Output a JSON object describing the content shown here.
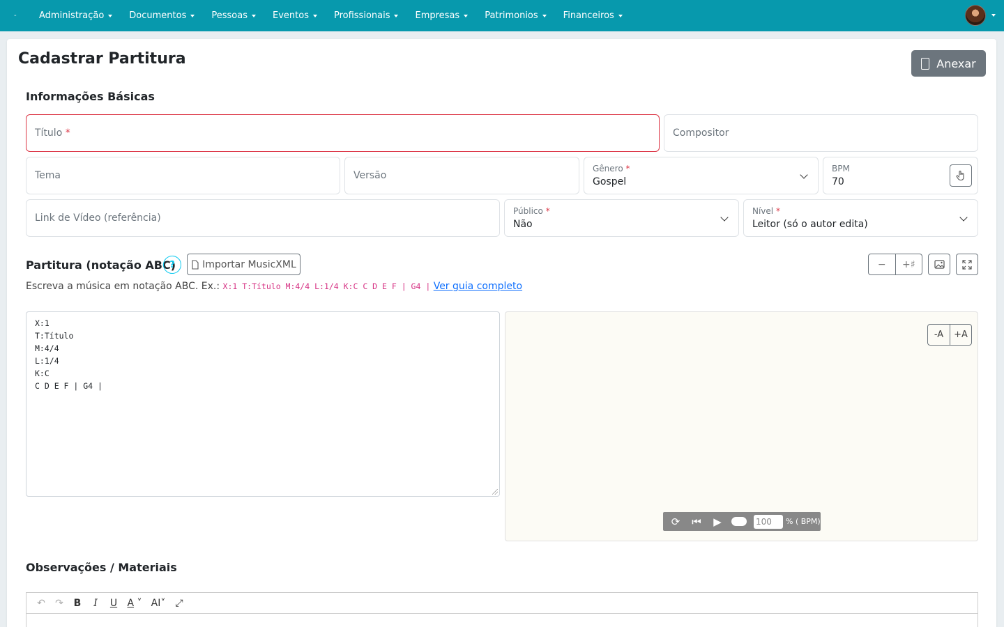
{
  "nav": {
    "brand": "-",
    "items": [
      "Administração",
      "Documentos",
      "Pessoas",
      "Eventos",
      "Profissionais",
      "Empresas",
      "Patrimonios",
      "Financeiros"
    ]
  },
  "page": {
    "title": "Cadastrar Partitura",
    "attach_label": "Anexar"
  },
  "basic": {
    "section_title": "Informações Básicas",
    "titulo_ph": "Título",
    "required_mark": "*",
    "compositor_ph": "Compositor",
    "tema_ph": "Tema",
    "versao_ph": "Versão",
    "genero_label": "Gênero",
    "genero_value": "Gospel",
    "bpm_label": "BPM",
    "bpm_value": "70",
    "video_ph": "Link de Vídeo (referência)",
    "publico_label": "Público",
    "publico_value": "Não",
    "nivel_label": "Nível",
    "nivel_value": "Leitor (só o autor edita)"
  },
  "score": {
    "title": "Partitura (notação ABC)",
    "help": "?",
    "import_label": "Importar MusicXML",
    "minus": "−",
    "sharp": "+♯",
    "hint_text": "Escreva a música em notação ABC. Ex.:",
    "hint_code": "X:1 T:Título M:4/4 L:1/4 K:C C D E F | G4 |",
    "hint_link": "Ver guia completo",
    "abc_lines": [
      "X:1",
      "T:Título",
      "M:4/4",
      "L:1/4",
      "K:C",
      "C D E F | G4 |"
    ],
    "zoom_minus": "-A",
    "zoom_plus": "+A",
    "player": {
      "tempo": "100",
      "unit": "% ( BPM)"
    }
  },
  "notes": {
    "section_title": "Observações / Materiais"
  }
}
